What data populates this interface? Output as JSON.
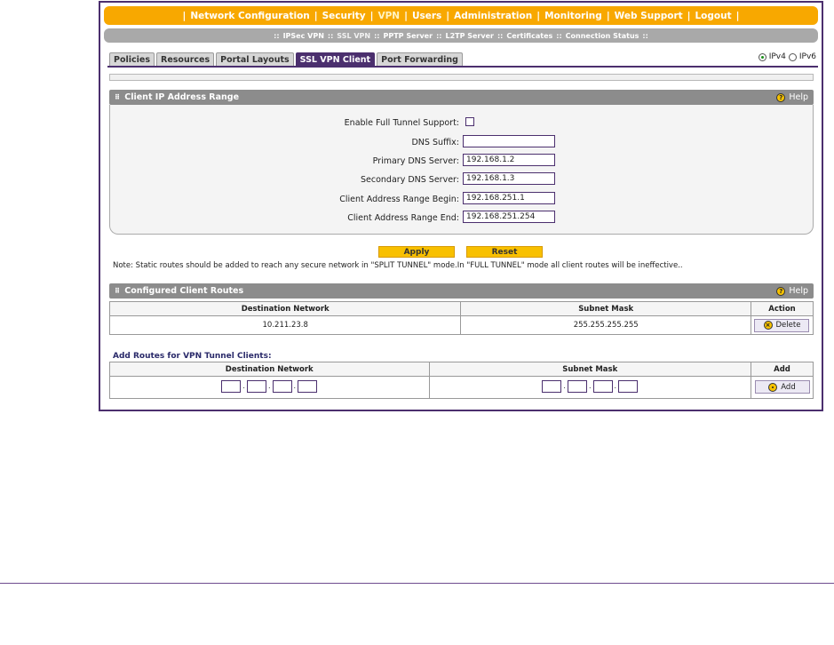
{
  "top_nav": {
    "items": [
      {
        "label": "Network Configuration"
      },
      {
        "label": "Security"
      },
      {
        "label": "VPN",
        "active": true
      },
      {
        "label": "Users"
      },
      {
        "label": "Administration"
      },
      {
        "label": "Monitoring"
      },
      {
        "label": "Web Support"
      },
      {
        "label": "Logout"
      }
    ]
  },
  "sub_nav": {
    "items": [
      {
        "label": "IPSec VPN"
      },
      {
        "label": "SSL VPN",
        "active": true
      },
      {
        "label": "PPTP Server"
      },
      {
        "label": "L2TP Server"
      },
      {
        "label": "Certificates"
      },
      {
        "label": "Connection Status"
      }
    ]
  },
  "tabs": [
    "Policies",
    "Resources",
    "Portal Layouts",
    "SSL VPN Client",
    "Port Forwarding"
  ],
  "active_tab": "SSL VPN Client",
  "ip_version": {
    "ipv4": "IPv4",
    "ipv6": "IPv6",
    "selected": "IPv4"
  },
  "client_ip_section": {
    "title": "Client IP Address Range",
    "help": "Help",
    "fields": {
      "full_tunnel_label": "Enable Full Tunnel Support:",
      "full_tunnel_checked": false,
      "dns_suffix_label": "DNS Suffix:",
      "dns_suffix_value": "",
      "primary_dns_label": "Primary DNS Server:",
      "primary_dns_value": "192.168.1.2",
      "secondary_dns_label": "Secondary DNS Server:",
      "secondary_dns_value": "192.168.1.3",
      "range_begin_label": "Client Address Range Begin:",
      "range_begin_value": "192.168.251.1",
      "range_end_label": "Client Address Range End:",
      "range_end_value": "192.168.251.254"
    }
  },
  "buttons": {
    "apply": "Apply",
    "reset": "Reset"
  },
  "note": "Note: Static routes should be added to reach any secure network in \"SPLIT TUNNEL\" mode.In \"FULL TUNNEL\" mode all client routes will be ineffective..",
  "routes_section": {
    "title": "Configured Client Routes",
    "help": "Help",
    "headers": {
      "dest": "Destination Network",
      "mask": "Subnet Mask",
      "action": "Action"
    },
    "rows": [
      {
        "dest": "10.211.23.8",
        "mask": "255.255.255.255",
        "action": "Delete"
      }
    ]
  },
  "add_routes": {
    "title": "Add Routes for VPN Tunnel Clients:",
    "headers": {
      "dest": "Destination Network",
      "mask": "Subnet Mask",
      "add": "Add"
    },
    "add_button": "Add"
  },
  "colors": {
    "nav_orange": "#f8a800",
    "brand_purple": "#4b2f6e",
    "button_yellow": "#f8c000",
    "section_gray": "#8c8c8c"
  }
}
